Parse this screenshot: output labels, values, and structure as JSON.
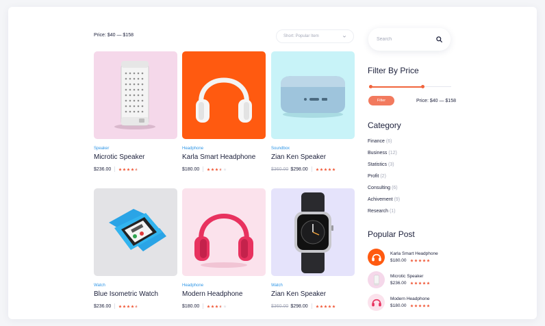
{
  "toolbar": {
    "price_range": "Price: $40 — $158",
    "sort_value": "Short: Popular Item"
  },
  "products": [
    {
      "category": "Speaker",
      "name": "Microtic Speaker",
      "old_price": "",
      "price": "$236.00",
      "rating": 4.5,
      "bg": "#f5d8ea",
      "icon": "speaker-icon"
    },
    {
      "category": "Headphone",
      "name": "Karla Smart Headphone",
      "old_price": "",
      "price": "$180.00",
      "rating": 3.5,
      "bg": "#ff5a10",
      "icon": "headphone-icon"
    },
    {
      "category": "Soundbox",
      "name": "Zian Ken Speaker",
      "old_price": "$360.00",
      "price": "$298.00",
      "rating": 5,
      "bg": "#c8f3f8",
      "icon": "soundbox-icon"
    },
    {
      "category": "Watch",
      "name": "Blue Isometric Watch",
      "old_price": "",
      "price": "$236.00",
      "rating": 4.5,
      "bg": "#e3e3e6",
      "icon": "smartwatch-icon"
    },
    {
      "category": "Headphone",
      "name": "Modern Headphone",
      "old_price": "",
      "price": "$180.00",
      "rating": 3.5,
      "bg": "#fbe2ec",
      "icon": "headphone-icon"
    },
    {
      "category": "Watch",
      "name": "Zian Ken Speaker",
      "old_price": "$360.00",
      "price": "$298.00",
      "rating": 5,
      "bg": "#e5e3fb",
      "icon": "smartwatch-icon"
    }
  ],
  "sidebar": {
    "search_placeholder": "Search",
    "filter_title": "Filter By Price",
    "price_slider": {
      "min": 0.0,
      "low": 0.0,
      "high": 0.65
    },
    "filter_button": "Filter",
    "filter_price": "Price: $40 — $158",
    "category_title": "Category",
    "categories": [
      {
        "name": "Finance",
        "count": "(6)"
      },
      {
        "name": "Business",
        "count": "(12)"
      },
      {
        "name": "Statistics",
        "count": "(3)"
      },
      {
        "name": "Profit",
        "count": "(2)"
      },
      {
        "name": "Consulting",
        "count": "(6)"
      },
      {
        "name": "Achivement",
        "count": "(9)"
      },
      {
        "name": "Research",
        "count": "(1)"
      }
    ],
    "popular_title": "Popular Post",
    "posts": [
      {
        "title": "Karla Smart Headphone",
        "price": "$180.00",
        "rating": 5,
        "bg": "#ff5a10",
        "icon": "headphone-icon"
      },
      {
        "title": "Microtic Speaker",
        "price": "$236.00",
        "rating": 5,
        "bg": "#f5d8ea",
        "icon": "speaker-icon"
      },
      {
        "title": "Modern Headphone",
        "price": "$180.00",
        "rating": 5,
        "bg": "#fbe2ec",
        "icon": "headphone-icon"
      }
    ]
  },
  "colors": {
    "accent": "#f1643c",
    "star": "#f05a3a",
    "link": "#2d95e6"
  }
}
